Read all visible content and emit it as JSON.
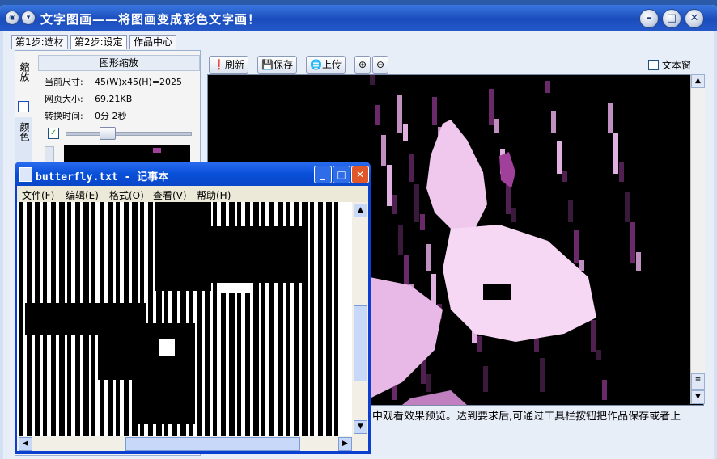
{
  "app": {
    "title": "文字图画——将图画变成彩色文字画！",
    "tabs": [
      "第1步:选材",
      "第2步:设定",
      "作品中心"
    ],
    "left_panel": {
      "vertical_tabs": [
        "缩放",
        "颜色"
      ],
      "zoom_header": "图形缩放",
      "info": [
        {
          "label": "当前尺寸:",
          "value": "45(W)x45(H)=2025"
        },
        {
          "label": "网页大小:",
          "value": "69.21KB"
        },
        {
          "label": "转换时间:",
          "value": "0分 2秒"
        }
      ]
    },
    "toolbar": {
      "refresh": "刷新",
      "save": "保存",
      "upload": "上传",
      "text_window": "文本窗"
    },
    "hint": "中观看效果预览。达到要求后,可通过工具栏按钮把作品保存或者上"
  },
  "notepad": {
    "title": "butterfly.txt - 记事本",
    "menu": [
      "文件(F)",
      "编辑(E)",
      "格式(O)",
      "查看(V)",
      "帮助(H)"
    ]
  },
  "colors": {
    "title_blue": "#1a4cbc",
    "pink": "#f0c8ee",
    "magenta": "#a0409a"
  }
}
